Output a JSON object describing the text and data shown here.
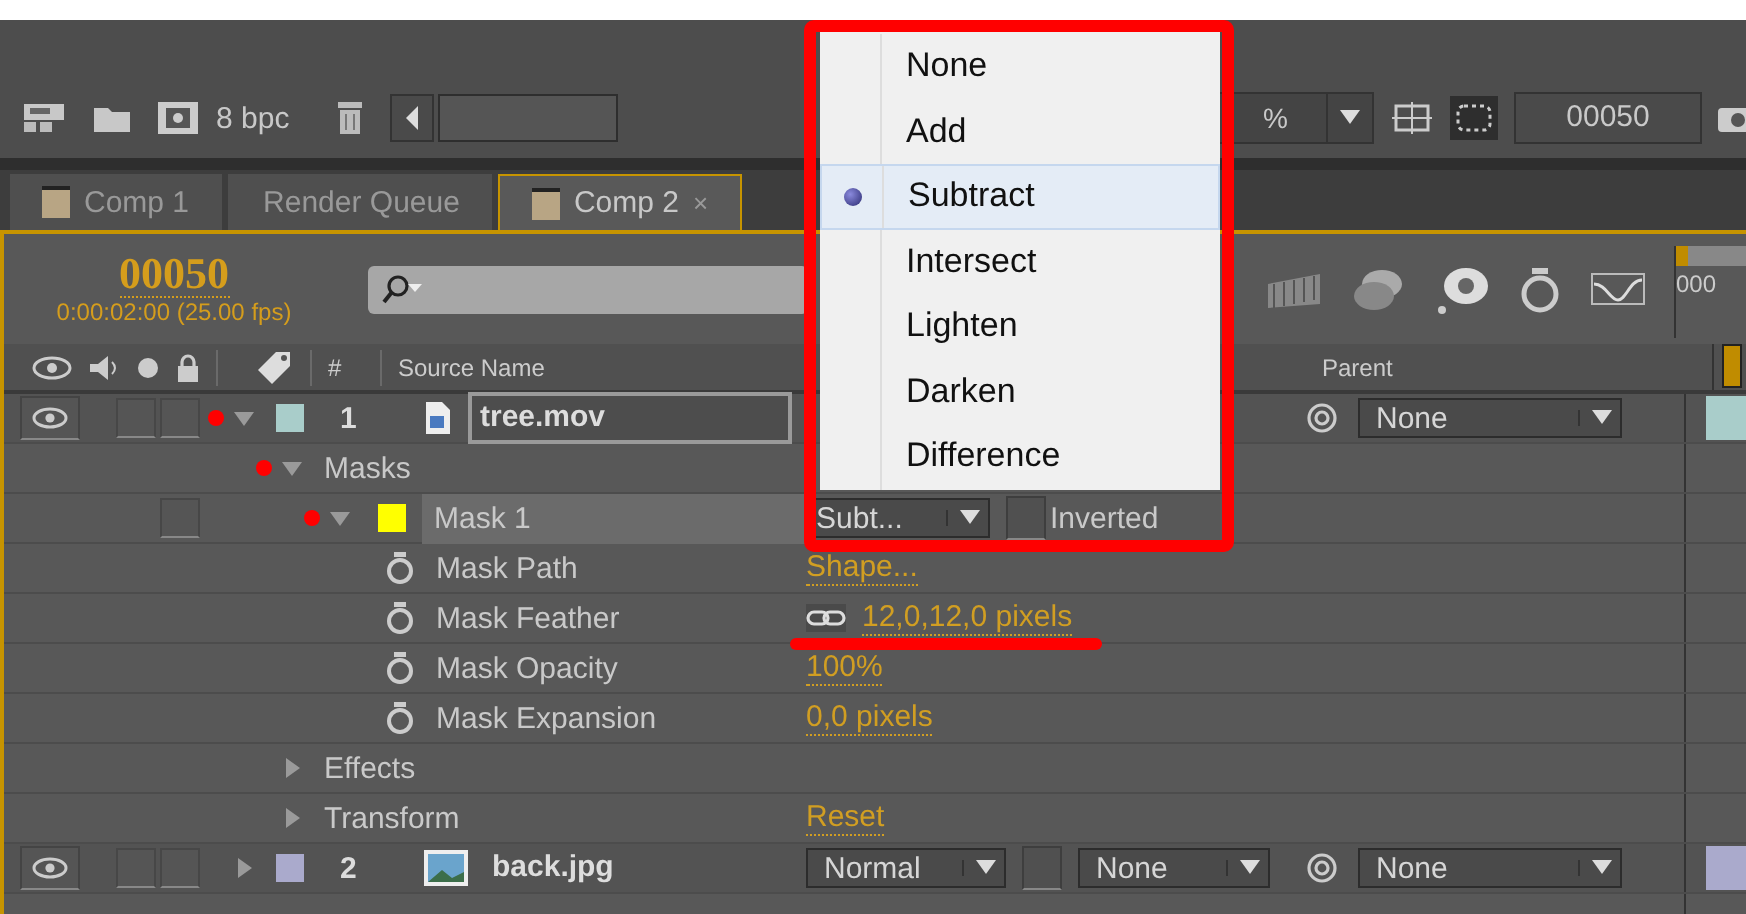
{
  "toolbar": {
    "depth": "8 bpc",
    "zoom": "%",
    "frame": "00050"
  },
  "tabs": [
    {
      "label": "Comp 1",
      "selected": false
    },
    {
      "label": "Render Queue",
      "selected": false
    },
    {
      "label": "Comp 2",
      "selected": true,
      "close": "×"
    }
  ],
  "timecode": {
    "frame": "00050",
    "time": "0:00:02:00 (25.00 fps)"
  },
  "ruler": "000",
  "columns": {
    "number": "#",
    "source_name": "Source Name",
    "parent": "Parent"
  },
  "layers": [
    {
      "kind": "layer",
      "number": "1",
      "name": "tree.mov",
      "file_icon": {
        "kind": "movie"
      },
      "renaming": true,
      "expanded": true,
      "marked": true,
      "color": "#a9cdca",
      "parent": "None",
      "children": [
        {
          "kind": "group",
          "label": "Masks",
          "expanded": true,
          "marked": true,
          "children": [
            {
              "kind": "mask",
              "label": "Mask 1",
              "expanded": true,
              "marked": true,
              "color": "#ffff00",
              "mode": "Subt...",
              "inverted": false,
              "inverted_label": "Inverted",
              "children": [
                {
                  "kind": "property",
                  "label": "Mask Path",
                  "value": "Shape..."
                },
                {
                  "kind": "property",
                  "label": "Mask Feather",
                  "value": "12,0,12,0 pixels",
                  "linked": true
                },
                {
                  "kind": "property",
                  "label": "Mask Opacity",
                  "value": "100%"
                },
                {
                  "kind": "property",
                  "label": "Mask Expansion",
                  "value": "0,0 pixels"
                }
              ]
            }
          ]
        },
        {
          "kind": "group",
          "label": "Effects",
          "expanded": false,
          "marked": false
        },
        {
          "kind": "group",
          "label": "Transform",
          "expanded": false,
          "marked": false,
          "value": "Reset"
        }
      ]
    },
    {
      "kind": "layer",
      "number": "2",
      "name": "back.jpg",
      "file_icon": {
        "kind": "still"
      },
      "preserve_transparency": false,
      "renaming": false,
      "expanded": false,
      "marked": false,
      "color": "#aaaacc",
      "mode": "Normal",
      "track_matte": "None",
      "parent": "None"
    }
  ],
  "mode_menu": {
    "items": [
      {
        "label": "None",
        "selected": false
      },
      {
        "label": "Add",
        "selected": false
      },
      {
        "label": "Subtract",
        "selected": true
      },
      {
        "label": "Intersect",
        "selected": false
      },
      {
        "label": "Lighten",
        "selected": false
      },
      {
        "label": "Darken",
        "selected": false
      },
      {
        "label": "Difference",
        "selected": false
      }
    ]
  }
}
